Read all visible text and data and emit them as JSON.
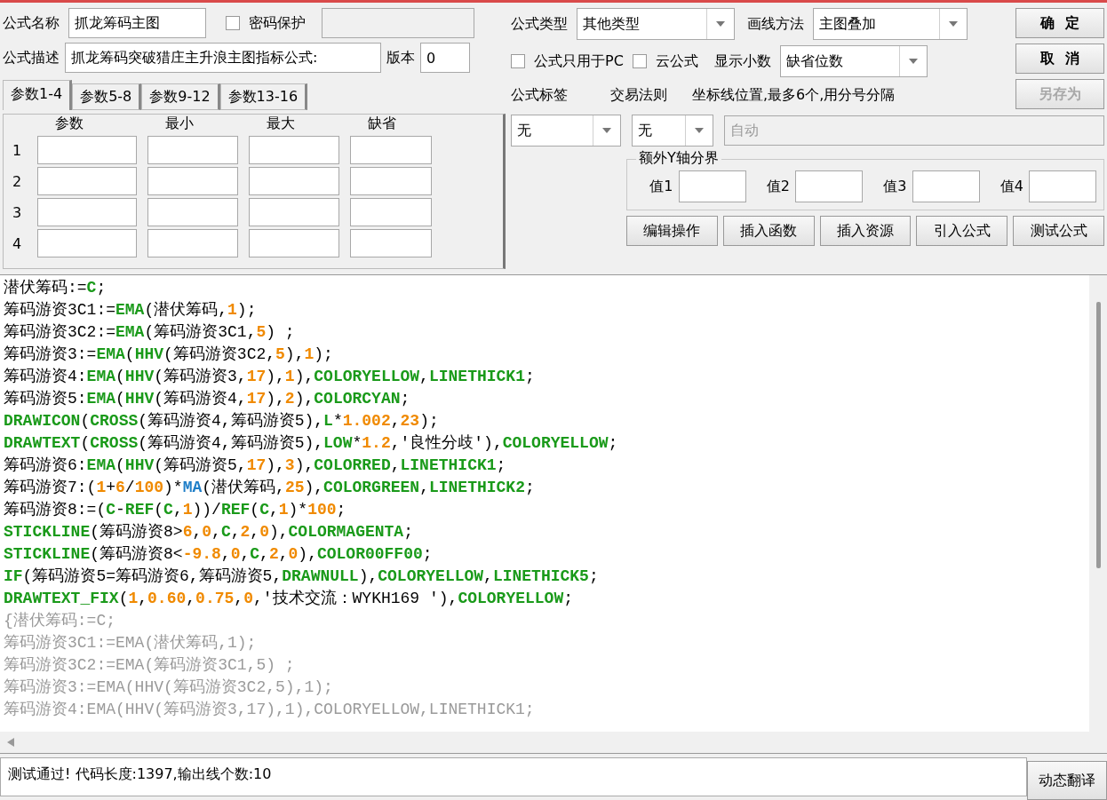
{
  "name": {
    "label": "公式名称",
    "value": "抓龙筹码主图"
  },
  "password": {
    "label": "密码保护",
    "checked": false
  },
  "description": {
    "label": "公式描述",
    "value": "抓龙筹码突破猎庄主升浪主图指标公式:"
  },
  "version": {
    "label": "版本",
    "value": "0"
  },
  "formula_type": {
    "label": "公式类型",
    "value": "其他类型"
  },
  "draw_method": {
    "label": "画线方法",
    "value": "主图叠加"
  },
  "pc_only": {
    "label": "公式只用于PC",
    "checked": false
  },
  "cloud": {
    "label": "云公式",
    "checked": false
  },
  "decimals": {
    "label": "显示小数",
    "value": "缺省位数"
  },
  "buttons": [
    {
      "label": "确  定",
      "disabled": false
    },
    {
      "label": "取  消",
      "disabled": false
    },
    {
      "label": "另存为",
      "disabled": true
    }
  ],
  "param_tabs": [
    {
      "label": "参数1-4",
      "selected": true
    },
    {
      "label": "参数5-8",
      "selected": false
    },
    {
      "label": "参数9-12",
      "selected": false
    },
    {
      "label": "参数13-16",
      "selected": false
    }
  ],
  "param_columns": [
    "参数",
    "最小",
    "最大",
    "缺省"
  ],
  "param_rows": [
    "1",
    "2",
    "3",
    "4"
  ],
  "tag": {
    "label": "公式标签",
    "value": "无"
  },
  "trade_rule": {
    "label": "交易法则",
    "value": "无"
  },
  "axis": {
    "label": "坐标线位置,最多6个,用分号分隔",
    "placeholder": "自动",
    "disabled": true
  },
  "y_axis": {
    "title": "额外Y轴分界",
    "fields": [
      "值1",
      "值2",
      "值3",
      "值4"
    ]
  },
  "tools": [
    "编辑操作",
    "插入函数",
    "插入资源",
    "引入公式",
    "测试公式"
  ],
  "code_lines": [
    [
      {
        "kind": "plain",
        "text": "潜伏筹码:="
      },
      {
        "kind": "func",
        "text": "C"
      },
      {
        "kind": "plain",
        "text": ";"
      }
    ],
    [
      {
        "kind": "plain",
        "text": "筹码游资3C1:="
      },
      {
        "kind": "func",
        "text": "EMA"
      },
      {
        "kind": "plain",
        "text": "(潜伏筹码,"
      },
      {
        "kind": "num",
        "text": "1"
      },
      {
        "kind": "plain",
        "text": ");"
      }
    ],
    [
      {
        "kind": "plain",
        "text": "筹码游资3C2:="
      },
      {
        "kind": "func",
        "text": "EMA"
      },
      {
        "kind": "plain",
        "text": "(筹码游资3C1,"
      },
      {
        "kind": "num",
        "text": "5"
      },
      {
        "kind": "plain",
        "text": ") ;"
      }
    ],
    [
      {
        "kind": "plain",
        "text": "筹码游资3:="
      },
      {
        "kind": "func",
        "text": "EMA"
      },
      {
        "kind": "plain",
        "text": "("
      },
      {
        "kind": "func",
        "text": "HHV"
      },
      {
        "kind": "plain",
        "text": "(筹码游资3C2,"
      },
      {
        "kind": "num",
        "text": "5"
      },
      {
        "kind": "plain",
        "text": "),"
      },
      {
        "kind": "num",
        "text": "1"
      },
      {
        "kind": "plain",
        "text": ");"
      }
    ],
    [
      {
        "kind": "plain",
        "text": "筹码游资4:"
      },
      {
        "kind": "func",
        "text": "EMA"
      },
      {
        "kind": "plain",
        "text": "("
      },
      {
        "kind": "func",
        "text": "HHV"
      },
      {
        "kind": "plain",
        "text": "(筹码游资3,"
      },
      {
        "kind": "num",
        "text": "17"
      },
      {
        "kind": "plain",
        "text": "),"
      },
      {
        "kind": "num",
        "text": "1"
      },
      {
        "kind": "plain",
        "text": "),"
      },
      {
        "kind": "func",
        "text": "COLORYELLOW"
      },
      {
        "kind": "plain",
        "text": ","
      },
      {
        "kind": "func",
        "text": "LINETHICK1"
      },
      {
        "kind": "plain",
        "text": ";"
      }
    ],
    [
      {
        "kind": "plain",
        "text": "筹码游资5:"
      },
      {
        "kind": "func",
        "text": "EMA"
      },
      {
        "kind": "plain",
        "text": "("
      },
      {
        "kind": "func",
        "text": "HHV"
      },
      {
        "kind": "plain",
        "text": "(筹码游资4,"
      },
      {
        "kind": "num",
        "text": "17"
      },
      {
        "kind": "plain",
        "text": "),"
      },
      {
        "kind": "num",
        "text": "2"
      },
      {
        "kind": "plain",
        "text": "),"
      },
      {
        "kind": "func",
        "text": "COLORCYAN"
      },
      {
        "kind": "plain",
        "text": ";"
      }
    ],
    [
      {
        "kind": "func",
        "text": "DRAWICON"
      },
      {
        "kind": "plain",
        "text": "("
      },
      {
        "kind": "func",
        "text": "CROSS"
      },
      {
        "kind": "plain",
        "text": "(筹码游资4,筹码游资5),"
      },
      {
        "kind": "func",
        "text": "L"
      },
      {
        "kind": "plain",
        "text": "*"
      },
      {
        "kind": "num",
        "text": "1.002"
      },
      {
        "kind": "plain",
        "text": ","
      },
      {
        "kind": "num",
        "text": "23"
      },
      {
        "kind": "plain",
        "text": ");"
      }
    ],
    [
      {
        "kind": "func",
        "text": "DRAWTEXT"
      },
      {
        "kind": "plain",
        "text": "("
      },
      {
        "kind": "func",
        "text": "CROSS"
      },
      {
        "kind": "plain",
        "text": "(筹码游资4,筹码游资5),"
      },
      {
        "kind": "func",
        "text": "LOW"
      },
      {
        "kind": "plain",
        "text": "*"
      },
      {
        "kind": "num",
        "text": "1.2"
      },
      {
        "kind": "plain",
        "text": ",'良性分歧'),"
      },
      {
        "kind": "func",
        "text": "COLORYELLOW"
      },
      {
        "kind": "plain",
        "text": ";"
      }
    ],
    [
      {
        "kind": "plain",
        "text": "筹码游资6:"
      },
      {
        "kind": "func",
        "text": "EMA"
      },
      {
        "kind": "plain",
        "text": "("
      },
      {
        "kind": "func",
        "text": "HHV"
      },
      {
        "kind": "plain",
        "text": "(筹码游资5,"
      },
      {
        "kind": "num",
        "text": "17"
      },
      {
        "kind": "plain",
        "text": "),"
      },
      {
        "kind": "num",
        "text": "3"
      },
      {
        "kind": "plain",
        "text": "),"
      },
      {
        "kind": "func",
        "text": "COLORRED"
      },
      {
        "kind": "plain",
        "text": ","
      },
      {
        "kind": "func",
        "text": "LINETHICK1"
      },
      {
        "kind": "plain",
        "text": ";"
      }
    ],
    [
      {
        "kind": "plain",
        "text": "筹码游资7:("
      },
      {
        "kind": "num",
        "text": "1"
      },
      {
        "kind": "plain",
        "text": "+"
      },
      {
        "kind": "num",
        "text": "6"
      },
      {
        "kind": "plain",
        "text": "/"
      },
      {
        "kind": "num",
        "text": "100"
      },
      {
        "kind": "plain",
        "text": ")*"
      },
      {
        "kind": "builtin",
        "text": "MA"
      },
      {
        "kind": "plain",
        "text": "(潜伏筹码,"
      },
      {
        "kind": "num",
        "text": "25"
      },
      {
        "kind": "plain",
        "text": "),"
      },
      {
        "kind": "func",
        "text": "COLORGREEN"
      },
      {
        "kind": "plain",
        "text": ","
      },
      {
        "kind": "func",
        "text": "LINETHICK2"
      },
      {
        "kind": "plain",
        "text": ";"
      }
    ],
    [
      {
        "kind": "plain",
        "text": "筹码游资8:=("
      },
      {
        "kind": "func",
        "text": "C"
      },
      {
        "kind": "plain",
        "text": "-"
      },
      {
        "kind": "func",
        "text": "REF"
      },
      {
        "kind": "plain",
        "text": "("
      },
      {
        "kind": "func",
        "text": "C"
      },
      {
        "kind": "plain",
        "text": ","
      },
      {
        "kind": "num",
        "text": "1"
      },
      {
        "kind": "plain",
        "text": "))/"
      },
      {
        "kind": "func",
        "text": "REF"
      },
      {
        "kind": "plain",
        "text": "("
      },
      {
        "kind": "func",
        "text": "C"
      },
      {
        "kind": "plain",
        "text": ","
      },
      {
        "kind": "num",
        "text": "1"
      },
      {
        "kind": "plain",
        "text": ")*"
      },
      {
        "kind": "num",
        "text": "100"
      },
      {
        "kind": "plain",
        "text": ";"
      }
    ],
    [
      {
        "kind": "func",
        "text": "STICKLINE"
      },
      {
        "kind": "plain",
        "text": "(筹码游资8>"
      },
      {
        "kind": "num",
        "text": "6"
      },
      {
        "kind": "plain",
        "text": ","
      },
      {
        "kind": "num",
        "text": "0"
      },
      {
        "kind": "plain",
        "text": ","
      },
      {
        "kind": "func",
        "text": "C"
      },
      {
        "kind": "plain",
        "text": ","
      },
      {
        "kind": "num",
        "text": "2"
      },
      {
        "kind": "plain",
        "text": ","
      },
      {
        "kind": "num",
        "text": "0"
      },
      {
        "kind": "plain",
        "text": "),"
      },
      {
        "kind": "func",
        "text": "COLORMAGENTA"
      },
      {
        "kind": "plain",
        "text": ";"
      }
    ],
    [
      {
        "kind": "func",
        "text": "STICKLINE"
      },
      {
        "kind": "plain",
        "text": "(筹码游资8<"
      },
      {
        "kind": "num",
        "text": "-9.8"
      },
      {
        "kind": "plain",
        "text": ","
      },
      {
        "kind": "num",
        "text": "0"
      },
      {
        "kind": "plain",
        "text": ","
      },
      {
        "kind": "func",
        "text": "C"
      },
      {
        "kind": "plain",
        "text": ","
      },
      {
        "kind": "num",
        "text": "2"
      },
      {
        "kind": "plain",
        "text": ","
      },
      {
        "kind": "num",
        "text": "0"
      },
      {
        "kind": "plain",
        "text": "),"
      },
      {
        "kind": "func",
        "text": "COLOR00FF00"
      },
      {
        "kind": "plain",
        "text": ";"
      }
    ],
    [
      {
        "kind": "func",
        "text": "IF"
      },
      {
        "kind": "plain",
        "text": "(筹码游资5=筹码游资6,筹码游资5,"
      },
      {
        "kind": "func",
        "text": "DRAWNULL"
      },
      {
        "kind": "plain",
        "text": "),"
      },
      {
        "kind": "func",
        "text": "COLORYELLOW"
      },
      {
        "kind": "plain",
        "text": ","
      },
      {
        "kind": "func",
        "text": "LINETHICK5"
      },
      {
        "kind": "plain",
        "text": ";"
      }
    ],
    [
      {
        "kind": "func",
        "text": "DRAWTEXT_FIX"
      },
      {
        "kind": "plain",
        "text": "("
      },
      {
        "kind": "num",
        "text": "1"
      },
      {
        "kind": "plain",
        "text": ","
      },
      {
        "kind": "num",
        "text": "0.60"
      },
      {
        "kind": "plain",
        "text": ","
      },
      {
        "kind": "num",
        "text": "0.75"
      },
      {
        "kind": "plain",
        "text": ","
      },
      {
        "kind": "num",
        "text": "0"
      },
      {
        "kind": "plain",
        "text": ",'技术交流：WYKH169 '),"
      },
      {
        "kind": "func",
        "text": "COLORYELLOW"
      },
      {
        "kind": "plain",
        "text": ";"
      }
    ],
    [
      {
        "kind": "comment",
        "text": "{潜伏筹码:=C;"
      }
    ],
    [
      {
        "kind": "comment",
        "text": "筹码游资3C1:=EMA(潜伏筹码,1);"
      }
    ],
    [
      {
        "kind": "comment",
        "text": "筹码游资3C2:=EMA(筹码游资3C1,5) ;"
      }
    ],
    [
      {
        "kind": "comment",
        "text": "筹码游资3:=EMA(HHV(筹码游资3C2,5),1);"
      }
    ],
    [
      {
        "kind": "comment",
        "text": "筹码游资4:EMA(HHV(筹码游资3,17),1),COLORYELLOW,LINETHICK1;"
      }
    ]
  ],
  "status": "测试通过! 代码长度:1397,输出线个数:10",
  "translate_button": "动态翻译"
}
